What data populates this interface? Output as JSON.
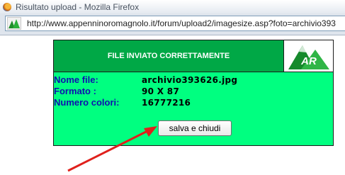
{
  "window": {
    "title": "Risultato upload - Mozilla Firefox",
    "icon": "firefox-icon"
  },
  "address_bar": {
    "url": "http://www.appenninoromagnolo.it/forum/upload2/imagesize.asp?foto=archivio393"
  },
  "panel": {
    "header_title": "FILE INVIATO CORRETTAMENTE",
    "logo_text": "AR",
    "rows": [
      {
        "label": "Nome file:",
        "value": "archivio393626.jpg"
      },
      {
        "label": "Formato :",
        "value": "90 X 87"
      },
      {
        "label": "Numero colori:",
        "value": "16777216"
      }
    ],
    "button_label": "salva e chiudi"
  },
  "colors": {
    "panel_bg": "#00ff80",
    "header_bg": "#00a846",
    "label_color": "#1010b0",
    "arrow": "#e0201c"
  }
}
